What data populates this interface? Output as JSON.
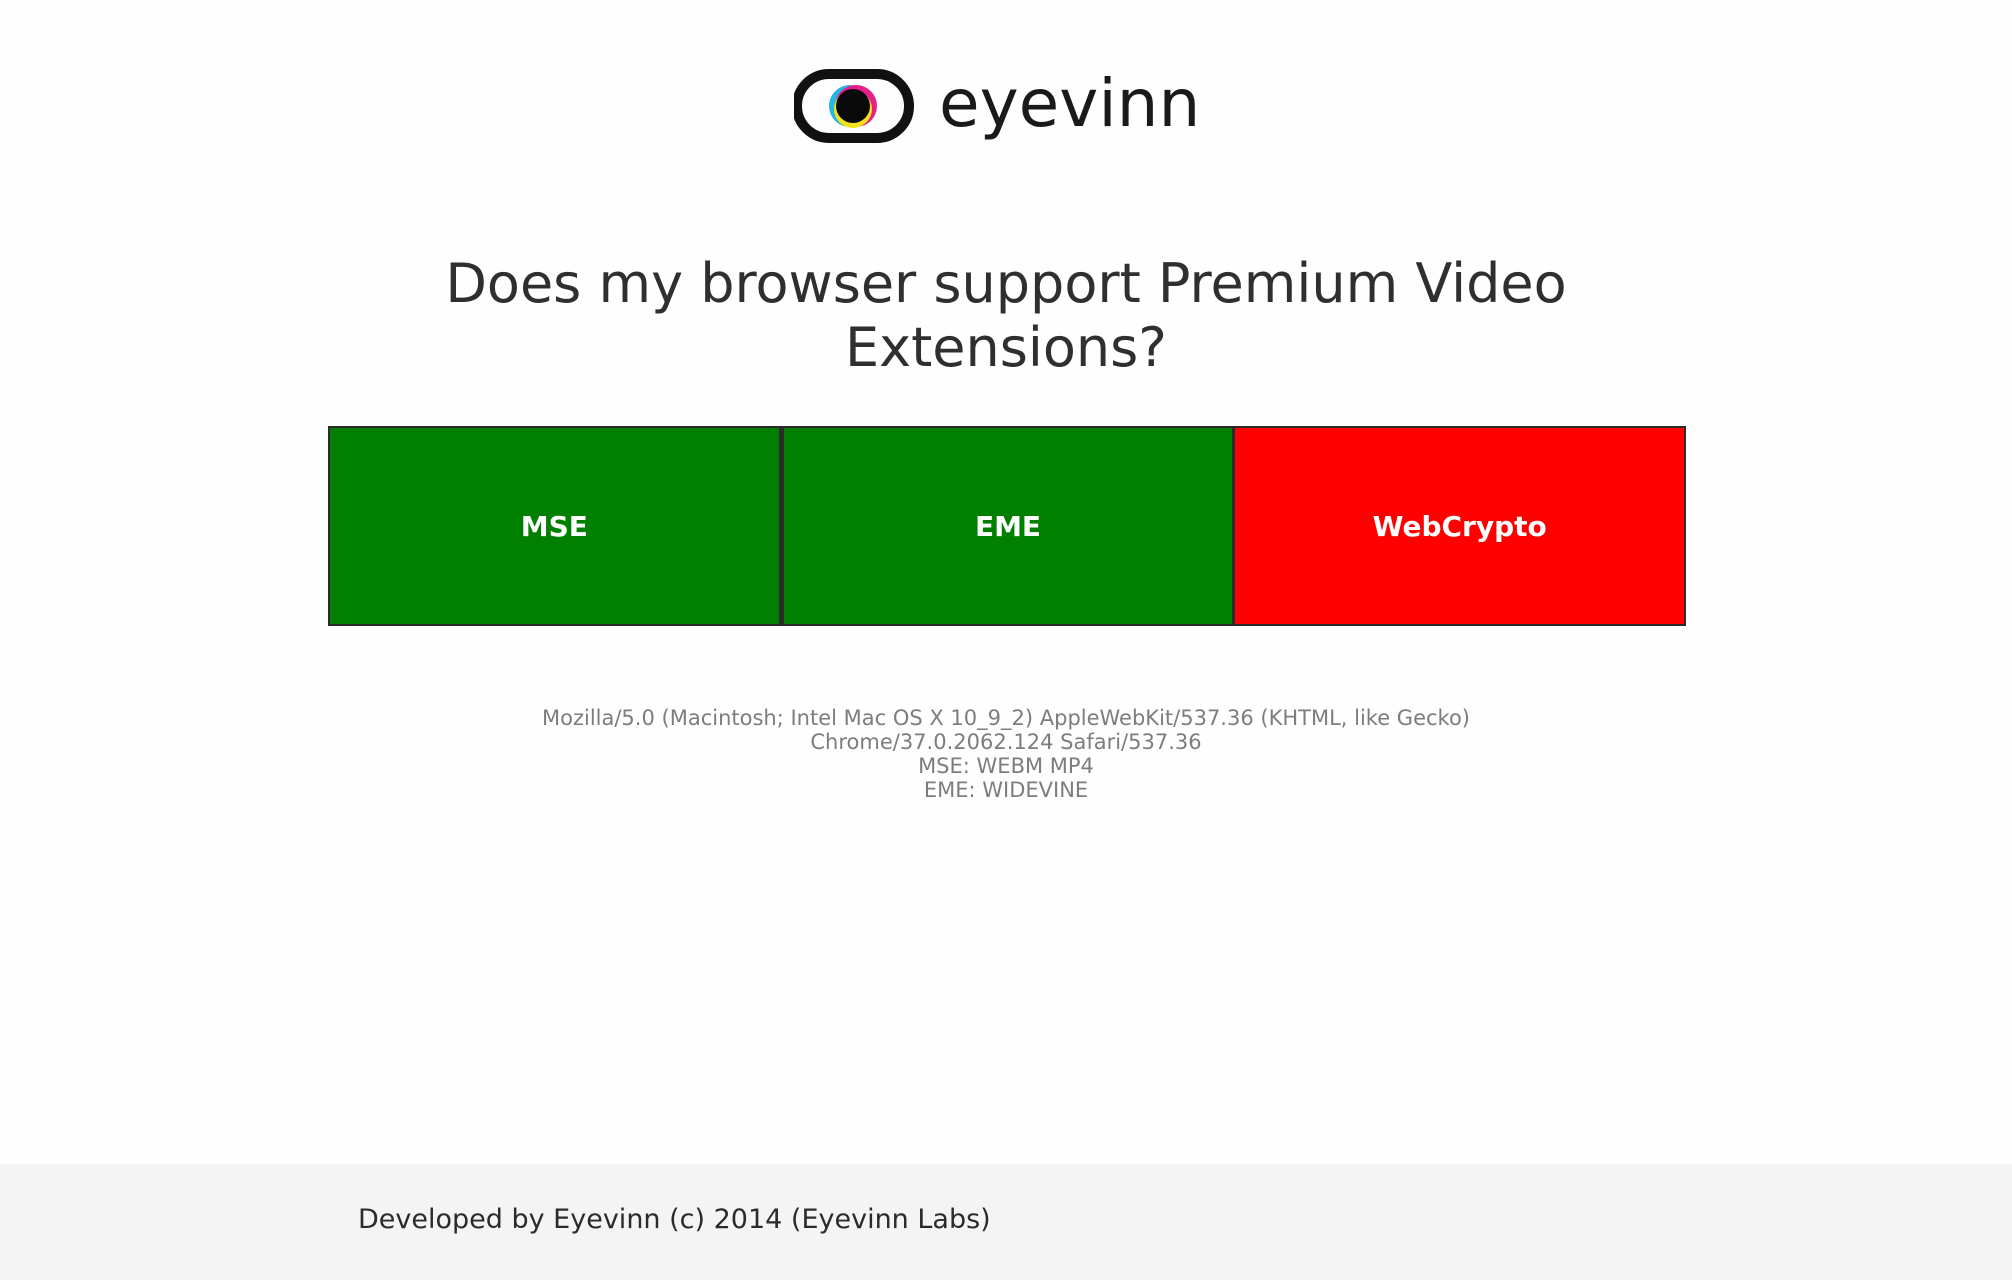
{
  "logo": {
    "wordmark": "eyevinn",
    "icon": "eye-logo-icon"
  },
  "heading": {
    "line1": "Does my browser support Premium Video",
    "line2": "Extensions?"
  },
  "features": [
    {
      "label": "MSE",
      "supported": true,
      "color": "#007f00"
    },
    {
      "label": "EME",
      "supported": true,
      "color": "#007f00"
    },
    {
      "label": "WebCrypto",
      "supported": false,
      "color": "#ff0000"
    }
  ],
  "info": {
    "user_agent_line1": "Mozilla/5.0 (Macintosh; Intel Mac OS X 10_9_2) AppleWebKit/537.36 (KHTML, like Gecko)",
    "user_agent_line2": "Chrome/37.0.2062.124 Safari/537.36",
    "mse": "MSE: WEBM MP4",
    "eme": "EME: WIDEVINE"
  },
  "footer": {
    "text": "Developed by Eyevinn (c) 2014 (Eyevinn Labs)"
  }
}
